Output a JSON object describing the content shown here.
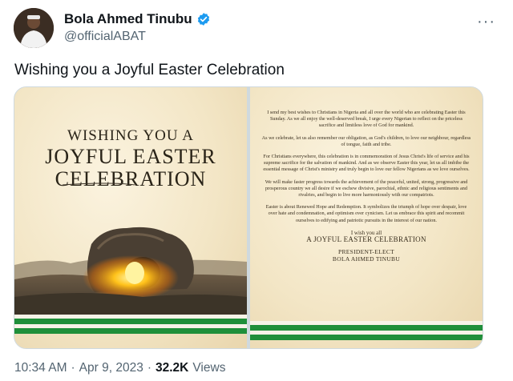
{
  "author": {
    "name": "Bola Ahmed Tinubu",
    "handle": "@officialABAT",
    "verified_color": "#1d9bf0"
  },
  "more_label": "···",
  "tweet": {
    "text": "Wishing you a Joyful Easter Celebration"
  },
  "media": {
    "left_panel": {
      "line1": "WISHING YOU A",
      "line2": "JOYFUL EASTER",
      "line3": "CELEBRATION"
    },
    "right_panel": {
      "paragraphs": [
        "I send my best wishes to Christians in Nigeria and all over the world who are celebrating Easter this Sunday. As we all enjoy the well-deserved break, I urge every Nigerian to reflect on the priceless sacrifice and limitless love of God for mankind.",
        "As we celebrate, let us also remember our obligation, as God's children, to love our neighbour, regardless of tongue, faith and tribe.",
        "For Christians everywhere, this celebration is in commemoration of Jesus Christ's life of service and his supreme sacrifice for the salvation of mankind. And as we observe Easter this year, let us all imbibe the essential message of Christ's ministry and truly begin to love our fellow Nigerians as we love ourselves.",
        "We will make faster progress towards the achievement of the peaceful, united, strong, progressive and prosperous country we all desire if we eschew divisive, parochial, ethnic and religious sentiments and rivalries, and begin to live more harmoniously with our compatriots.",
        "Easter is about Renewed Hope and Redemption. It symbolizes the triumph of hope over despair, love over hate and condemnation, and optimism over cynicism. Let us embrace this spirit and recommit ourselves to edifying and patriotic pursuits in the interest of our nation."
      ],
      "wish_line": "I wish you all",
      "wish_big": "A JOYFUL EASTER CELEBRATION",
      "sign_title": "PRESIDENT-ELECT",
      "sign_name": "BOLA AHMED TINUBU"
    },
    "flag_green": "#1f8f3a"
  },
  "footer": {
    "time": "10:34 AM",
    "sep1": "·",
    "date": "Apr 9, 2023",
    "sep2": "·",
    "views_count": "32.2K",
    "views_label": "Views"
  }
}
